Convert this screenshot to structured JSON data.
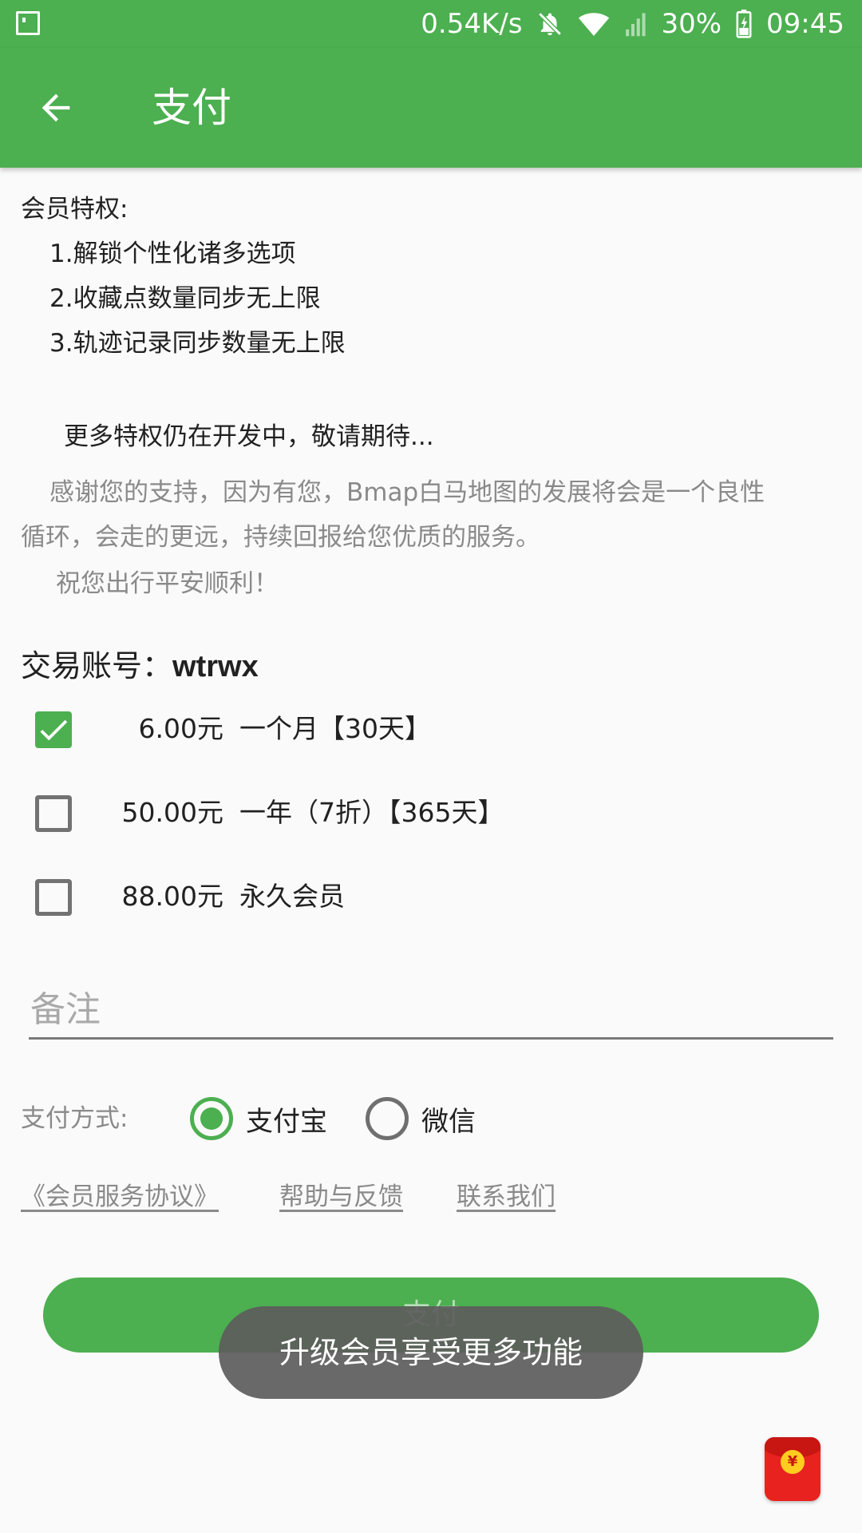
{
  "status_bar": {
    "network_speed": "0.54K/s",
    "battery": "30%",
    "time": "09:45",
    "icons": [
      "notification-icon",
      "mute-icon",
      "wifi-icon",
      "signal-icon",
      "battery-icon"
    ]
  },
  "app_bar": {
    "title": "支付",
    "back_icon": "arrow-left-icon"
  },
  "benefits": {
    "heading": "会员特权:",
    "items": [
      "1.解锁个性化诸多选项",
      "2.收藏点数量同步无上限",
      "3.轨迹记录同步数量无上限"
    ],
    "more_note": "更多特权仍在开发中，敬请期待...",
    "thanks_line1": "感谢您的支持，因为有您，Bmap白马地图的发展将会是一个良性",
    "thanks_line2": "循环，会走的更远，持续回报给您优质的服务。",
    "wish": "祝您出行平安顺利！"
  },
  "account": {
    "label": "交易账号：",
    "value": "wtrwx"
  },
  "plans": [
    {
      "price": "6.00元",
      "desc": "一个月【30天】",
      "checked": true
    },
    {
      "price": "50.00元",
      "desc": "一年（7折）【365天】",
      "checked": false
    },
    {
      "price": "88.00元",
      "desc": "永久会员",
      "checked": false
    }
  ],
  "remark": {
    "placeholder": "备注",
    "value": ""
  },
  "payment": {
    "label": "支付方式:",
    "options": [
      {
        "label": "支付宝",
        "selected": true
      },
      {
        "label": "微信",
        "selected": false
      }
    ]
  },
  "links": {
    "agreement": "《会员服务协议》",
    "help": "帮助与反馈",
    "contact": "联系我们"
  },
  "pay_button": {
    "label": "支付"
  },
  "toast": {
    "message": "升级会员享受更多功能"
  },
  "red_packet": {
    "icon": "red-packet-icon",
    "symbol": "¥"
  },
  "colors": {
    "primary": "#4caf50",
    "toast_bg": "#5c5c5c",
    "red_packet": "#e8231f"
  }
}
